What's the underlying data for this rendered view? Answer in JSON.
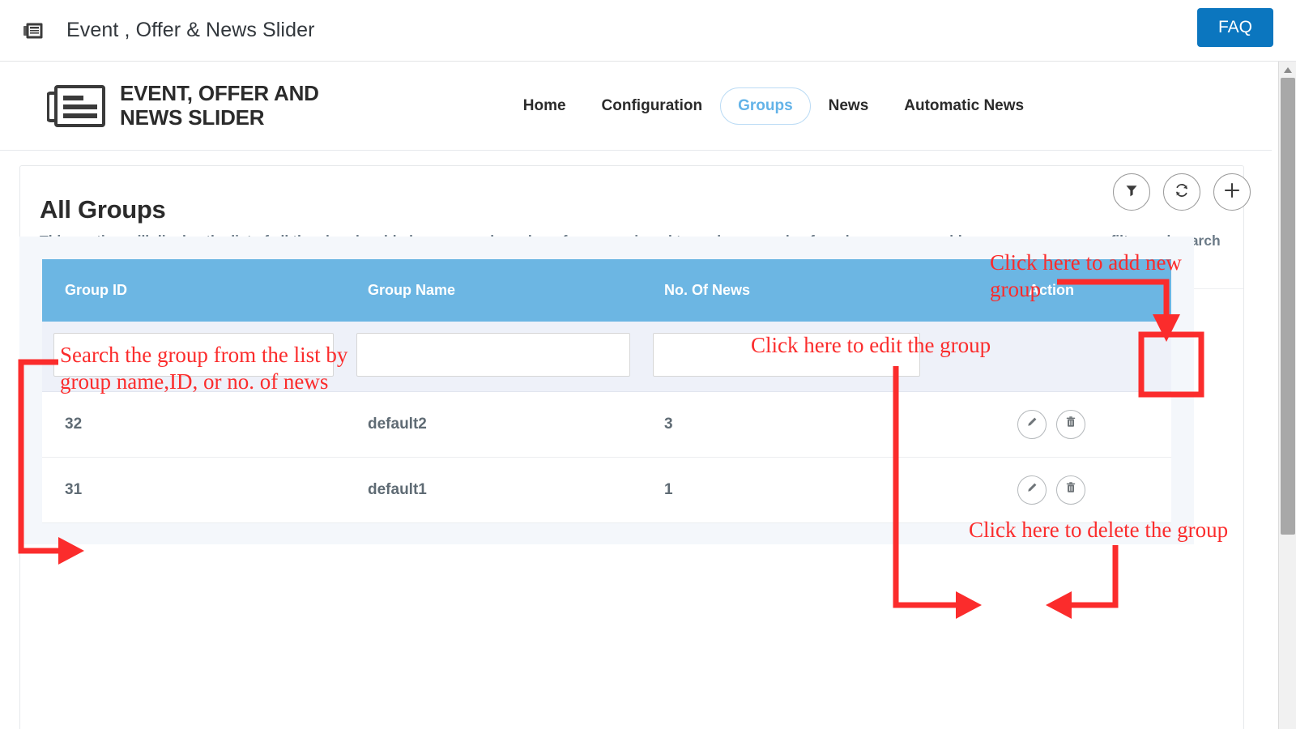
{
  "adminbar": {
    "icon": "slider-card-icon",
    "title": "Event , Offer & News Slider",
    "faq_label": "FAQ"
  },
  "plugin_header": {
    "logo_icon": "news-card-icon",
    "brand_line1": "EVENT, OFFER AND",
    "brand_line2": "NEWS SLIDER",
    "nav": [
      {
        "label": "Home",
        "active": false
      },
      {
        "label": "Configuration",
        "active": false
      },
      {
        "label": "Groups",
        "active": true
      },
      {
        "label": "News",
        "active": false
      },
      {
        "label": "Automatic News",
        "active": false
      }
    ]
  },
  "panel": {
    "title": "All Groups",
    "description": "This section will display the list of all the already added groups and number of news assigned to each group, also from here you can add new groups, you can filter and search among the list of group, you can edit or delete the existing group and much more."
  },
  "toolbar": {
    "filter_icon": "filter-funnel-icon",
    "refresh_icon": "refresh-icon",
    "add_icon": "plus-icon"
  },
  "table": {
    "columns": [
      "Group ID",
      "Group Name",
      "No. Of News",
      "Action"
    ],
    "filters": {
      "group_id": "",
      "group_name": "",
      "no_of_news": "",
      "placeholder": ""
    },
    "rows": [
      {
        "group_id": "32",
        "group_name": "default2",
        "no_of_news": "3",
        "edit_icon": "pencil-icon",
        "delete_icon": "trash-icon"
      },
      {
        "group_id": "31",
        "group_name": "default1",
        "no_of_news": "1",
        "edit_icon": "pencil-icon",
        "delete_icon": "trash-icon"
      }
    ]
  },
  "annotations": {
    "search": "Search the group from the list by\ngroup name,ID, or no. of news",
    "add_new": "Click here to add new\n    group",
    "edit": "Click here to edit the group",
    "delete": "Click here to delete the group"
  },
  "colors": {
    "accent_blue": "#0b76bf",
    "table_header_blue": "#6cb6e3",
    "nav_active": "#63b3e8",
    "annotation_red": "#fb2c2c",
    "description_gray": "#6b7a87"
  }
}
